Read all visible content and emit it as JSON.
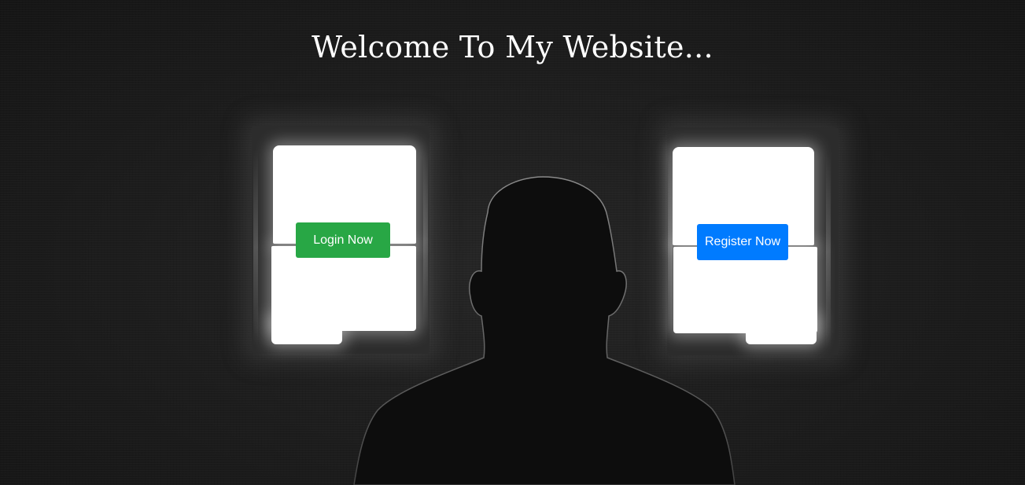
{
  "hero": {
    "title": "Welcome To My Website..."
  },
  "actions": {
    "login_label": "Login Now",
    "register_label": "Register Now"
  },
  "colors": {
    "background": "#1e1e1e",
    "login_button": "#28a745",
    "register_button": "#007bff",
    "title_text": "#ffffff"
  }
}
